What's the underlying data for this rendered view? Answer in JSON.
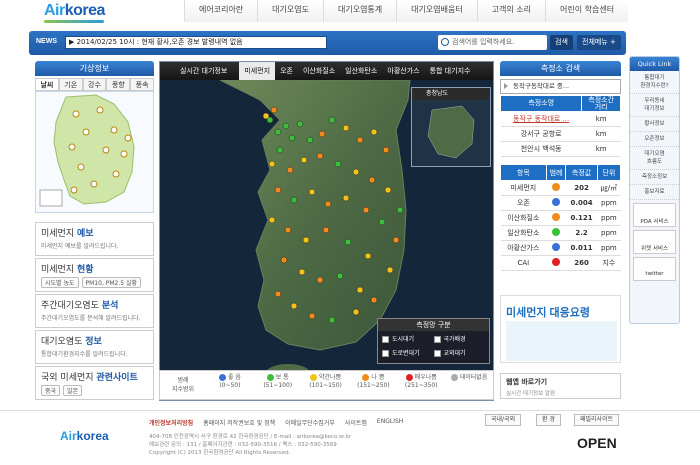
{
  "header": {
    "logo_air": "Air",
    "logo_korea": "korea",
    "nav": [
      "에어코리아란",
      "대기오염도",
      "대기오염통계",
      "대기오염배움터",
      "고객의 소리",
      "어린이 학습센터"
    ]
  },
  "newsbar": {
    "label": "NEWS",
    "ticker": "▶ 2014/02/25 10시 : 현재 황사,오존 경보 발령내역 없음",
    "search_placeholder": "검색어를 입력하세요.",
    "search_button": "검색",
    "sitemap_button": "전체메뉴 +"
  },
  "weather": {
    "title": "기상정보",
    "tabs": [
      "날씨",
      "기온",
      "강수",
      "풍향",
      "풍속"
    ]
  },
  "promos": [
    {
      "title_a": "미세먼지",
      "title_b": "예보",
      "sub": "미세먼지 예보를 알려드립니다."
    },
    {
      "title_a": "미세먼지",
      "title_b": "현황",
      "sub": "",
      "pills": [
        "시도별 농도",
        "PM10, PM2.5 실황"
      ]
    },
    {
      "title_a": "주간대기오염도",
      "title_b": "분석",
      "sub": "주간대기오염도를 분석해 알려드립니다."
    },
    {
      "title_a": "대기오염도",
      "title_b": "정보",
      "sub": "통합대기환경지수를 알려드립니다."
    },
    {
      "title_a": "국외 미세먼지",
      "title_b": "관련사이트",
      "sub": "",
      "pills": [
        "중국",
        "일본"
      ]
    }
  ],
  "map": {
    "tabs": [
      "실시간 대기정보",
      "미세먼지",
      "오존",
      "이산화질소",
      "일산화탄소",
      "아황산가스",
      "통합 대기지수"
    ],
    "active_tab": 1,
    "overview_label": "충청남도",
    "legend_title": "측정망 구분",
    "legend_items": [
      "도시대기",
      "국가배경",
      "도로변대기",
      "교외대기"
    ],
    "grade_label": "범례\n지수범위",
    "grades": [
      {
        "name": "좋 음",
        "range": "(0~50)",
        "color": "#3a6fd8"
      },
      {
        "name": "보 통",
        "range": "(51~100)",
        "color": "#3bbf3b"
      },
      {
        "name": "약간나쁨",
        "range": "(101~150)",
        "color": "#f2c21b"
      },
      {
        "name": "나 쁨",
        "range": "(151~250)",
        "color": "#f08c1c"
      },
      {
        "name": "매우나쁨",
        "range": "(251~350)",
        "color": "#e02020"
      },
      {
        "name": "데이터없음",
        "range": "",
        "color": "#aaaaaa"
      }
    ]
  },
  "station": {
    "title": "측정소 검색",
    "selected": "동작구동작대로 중...",
    "head1": [
      "측정소명",
      "측정소간\n거리"
    ],
    "stations": [
      {
        "name": "동작구 동작대로 ...",
        "unit": "km"
      },
      {
        "name": "강서구 공항로",
        "unit": "km"
      },
      {
        "name": "천안시 백석동",
        "unit": "km"
      }
    ],
    "head2": [
      "항목",
      "범례",
      "측정값",
      "단위"
    ],
    "items": [
      {
        "name": "미세먼지",
        "color": "#f08c1c",
        "value": "202",
        "unit": "㎍/㎥"
      },
      {
        "name": "오존",
        "color": "#3a6fd8",
        "value": "0.004",
        "unit": "ppm"
      },
      {
        "name": "이산화질소",
        "color": "#f08c1c",
        "value": "0.121",
        "unit": "ppm"
      },
      {
        "name": "일산화탄소",
        "color": "#3bbf3b",
        "value": "2.2",
        "unit": "ppm"
      },
      {
        "name": "아황산가스",
        "color": "#3a6fd8",
        "value": "0.011",
        "unit": "ppm"
      },
      {
        "name": "CAI",
        "color": "#e02020",
        "value": "260",
        "unit": "지수"
      }
    ]
  },
  "ad": {
    "title": "미세먼지 대응요령",
    "badge": "고농도"
  },
  "webapp": {
    "title": "웹앱 바로가기",
    "sub": "실시간 대기정보 알림"
  },
  "quicklink": {
    "title": "Quick Link",
    "items": [
      "통합대기\n환경지수란?",
      "우리동네\n대기정보",
      "황사정보",
      "오존정보",
      "대기오염\n흐름도",
      "측정소정보",
      "홍보자료"
    ],
    "boxes": [
      "PDA 서비스",
      "위젯 서비스",
      "twitter"
    ]
  },
  "footer": {
    "links": [
      "개인정보처리방침",
      "홈페이지 저작권보호 및 정책",
      "이메일무단수집거부",
      "사이트맵",
      "ENGLISH"
    ],
    "selects": [
      "국내/국외",
      "환 경",
      "패밀리사이트"
    ],
    "addr1": "404-708 인천광역시 서구 환경로 42 한국환경공단  /  E-mail : airkorea@keco.or.kr",
    "addr2": "예보관련 문의 : 131 / 홈페이지관련 : 032-590-3516 / 팩스 : 032-590-3569",
    "copy": "Copyright (C) 2013 한국환경공단 All Rights Reserved.",
    "open": "OPEN"
  }
}
